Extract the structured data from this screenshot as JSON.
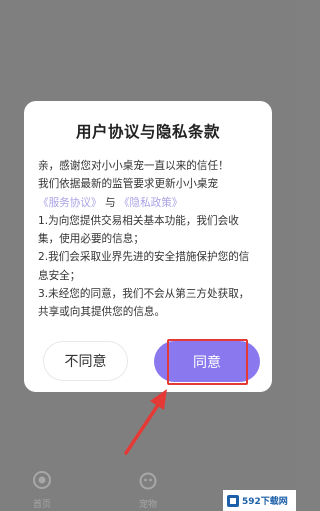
{
  "dialog": {
    "title": "用户协议与隐私条款",
    "lines": [
      "亲，感谢您对小小桌宠一直以来的信任！",
      "我们依据最新的监管要求更新小小桌宠",
      "1.为向您提供交易相关基本功能，我们会收",
      "集，使用必要的信息；",
      "2.我们会采取业界先进的安全措施保护您的信",
      "息安全；",
      "3.未经您的同意，我们不会从第三方处获取，",
      "共享或向其提供您的信息。"
    ],
    "link_user_agreement": "《服务协议》",
    "link_connector": "与",
    "link_privacy": "《隐私政策》",
    "disagree_label": "不同意",
    "agree_label": "同意"
  },
  "tabbar": {
    "tab1_label": "首页",
    "tab2_label": "宠物"
  },
  "watermark": {
    "text": "592下载网"
  },
  "colors": {
    "accent": "#8a79ee",
    "link": "#a9a2e6",
    "highlight": "#e53935"
  }
}
